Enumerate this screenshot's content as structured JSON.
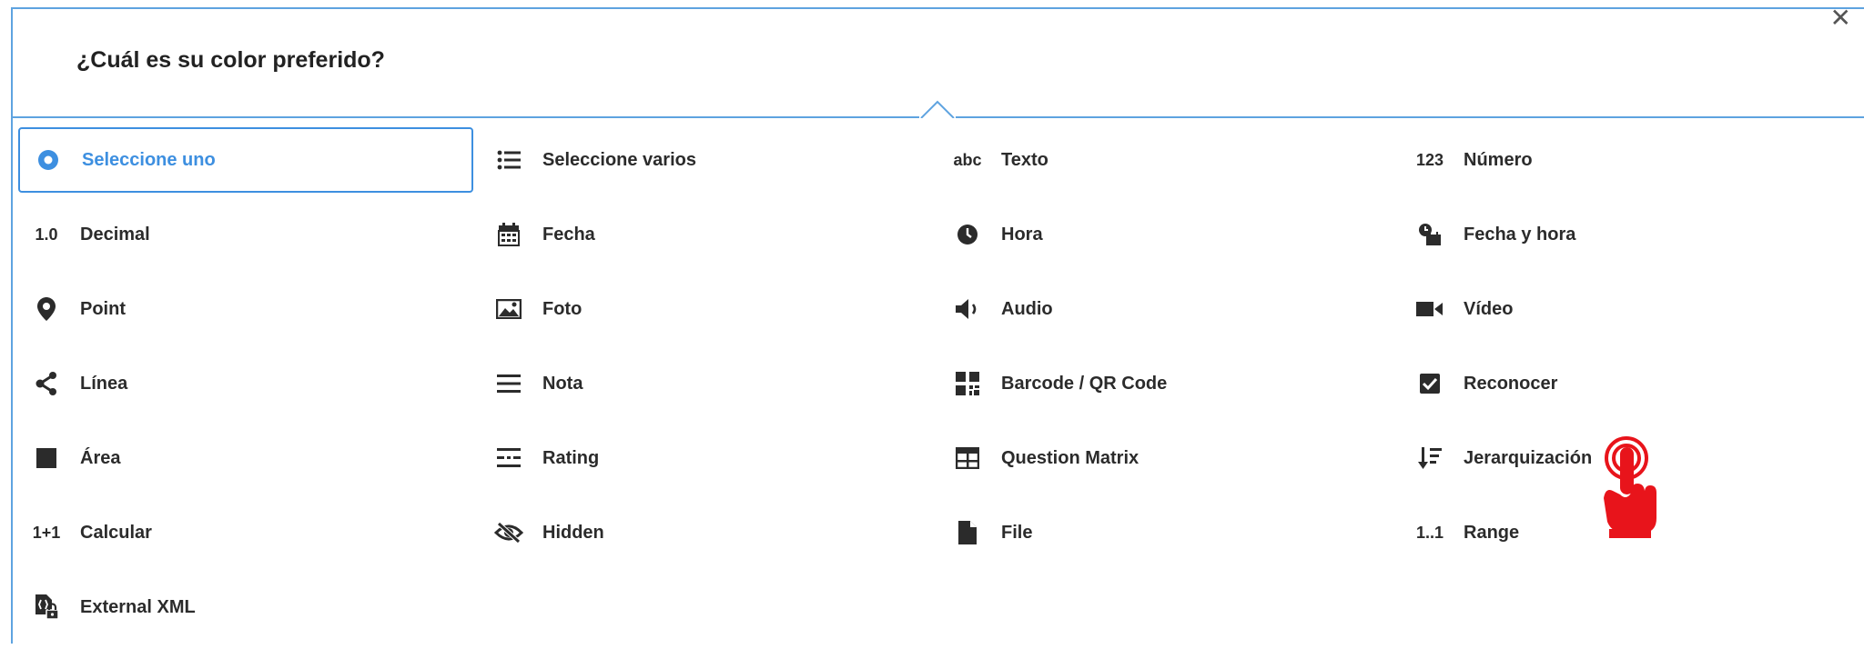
{
  "dialog": {
    "question": "¿Cuál es su color preferido?",
    "close_label": "✕"
  },
  "items": [
    {
      "label": "Seleccione uno",
      "icon": "radio-selected-icon",
      "selected": true
    },
    {
      "label": "Seleccione varios",
      "icon": "list-icon",
      "selected": false
    },
    {
      "label": "Texto",
      "icon": "abc-text-icon",
      "glyph": "abc",
      "selected": false
    },
    {
      "label": "Número",
      "icon": "number-icon",
      "glyph": "123",
      "selected": false
    },
    {
      "label": "Decimal",
      "icon": "decimal-icon",
      "glyph": "1.0",
      "selected": false
    },
    {
      "label": "Fecha",
      "icon": "calendar-icon",
      "selected": false
    },
    {
      "label": "Hora",
      "icon": "clock-icon",
      "selected": false
    },
    {
      "label": "Fecha y hora",
      "icon": "date-time-icon",
      "selected": false
    },
    {
      "label": "Point",
      "icon": "map-pin-icon",
      "selected": false
    },
    {
      "label": "Foto",
      "icon": "photo-icon",
      "selected": false
    },
    {
      "label": "Audio",
      "icon": "speaker-icon",
      "selected": false
    },
    {
      "label": "Vídeo",
      "icon": "video-camera-icon",
      "selected": false
    },
    {
      "label": "Línea",
      "icon": "share-line-icon",
      "selected": false
    },
    {
      "label": "Nota",
      "icon": "note-lines-icon",
      "selected": false
    },
    {
      "label": "Barcode / QR Code",
      "icon": "qr-code-icon",
      "selected": false
    },
    {
      "label": "Reconocer",
      "icon": "checkbox-icon",
      "selected": false
    },
    {
      "label": "Área",
      "icon": "square-icon",
      "selected": false
    },
    {
      "label": "Rating",
      "icon": "rating-icon",
      "selected": false
    },
    {
      "label": "Question Matrix",
      "icon": "table-icon",
      "selected": false
    },
    {
      "label": "Jerarquización",
      "icon": "sort-icon",
      "selected": false
    },
    {
      "label": "Calcular",
      "icon": "calculate-icon",
      "glyph": "1+1",
      "selected": false
    },
    {
      "label": "Hidden",
      "icon": "eye-slash-icon",
      "selected": false
    },
    {
      "label": "File",
      "icon": "file-icon",
      "selected": false
    },
    {
      "label": "Range",
      "icon": "range-icon",
      "glyph": "1..1",
      "selected": false
    },
    {
      "label": "External XML",
      "icon": "external-xml-icon",
      "selected": false
    }
  ],
  "colors": {
    "accent": "#3d8fe0",
    "border": "#5ea3e0",
    "cursor": "#e8141b"
  }
}
